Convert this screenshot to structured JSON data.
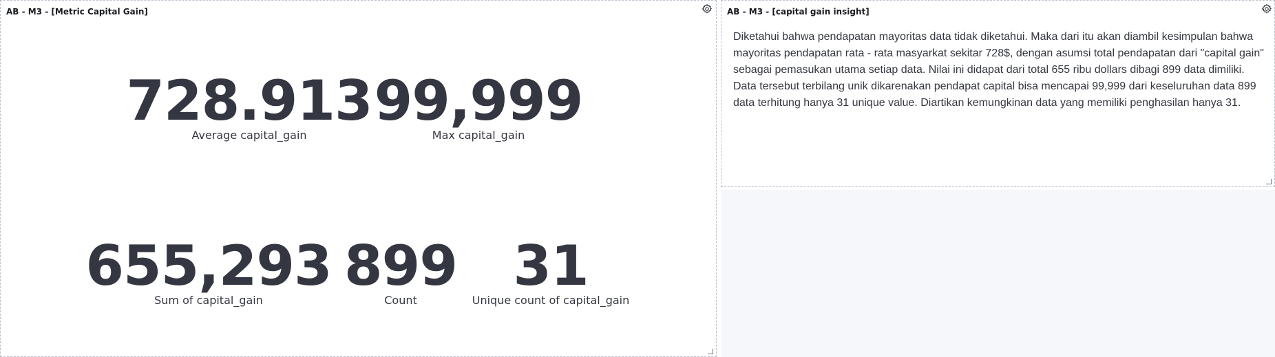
{
  "left_panel": {
    "title": "AB - M3 - [Metric Capital Gain]",
    "gear_icon": "gear-icon",
    "metrics": [
      {
        "value": "728.913",
        "label": "Average capital_gain"
      },
      {
        "value": "99,999",
        "label": "Max capital_gain"
      },
      {
        "value": "655,293",
        "label": "Sum of capital_gain"
      },
      {
        "value": "899",
        "label": "Count"
      },
      {
        "value": "31",
        "label": "Unique count of capital_gain"
      }
    ]
  },
  "right_panel": {
    "title": "AB - M3 - [capital gain insight]",
    "gear_icon": "gear-icon",
    "insight": "Diketahui bahwa pendapatan mayoritas data tidak diketahui. Maka dari itu akan diambil kesimpulan bahwa mayoritas pendapatan rata - rata masyarkat sekitar 728$, dengan asumsi total pendapatan dari \"capital gain\" sebagai pemasukan utama setiap data. Nilai ini didapat dari total 655 ribu dollars dibagi 899 data dimiliki. Data tersebut terbilang unik dikarenakan pendapat capital bisa mencapai 99,999 dari keseluruhan data 899 data terhitung hanya 31 unique value. Diartikan kemungkinan data yang memiliki penghasilan hanya 31."
  },
  "colors": {
    "metric_text": "#343741",
    "panel_border": "#b9c0cc",
    "empty_background": "#f5f7fa"
  }
}
